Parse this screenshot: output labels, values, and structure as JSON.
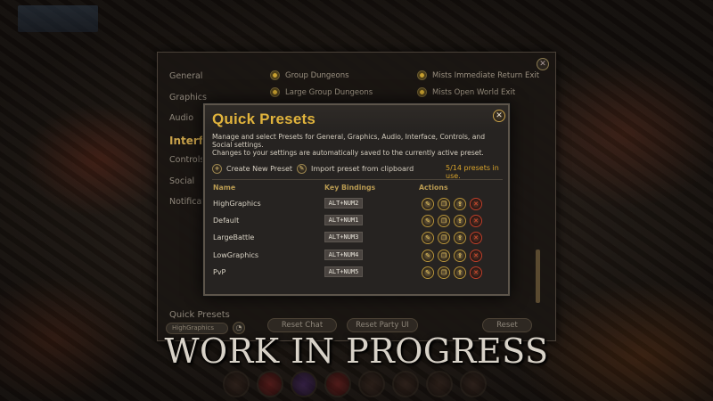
{
  "settings_window": {
    "nav": [
      "General",
      "Graphics",
      "Audio",
      "Interfa",
      "Controls",
      "Social",
      "Notificat"
    ],
    "active_nav": 3,
    "options_left": [
      "Group Dungeons",
      "Large Group Dungeons"
    ],
    "options_right": [
      "Mists Immediate Return Exit",
      "Mists Open World Exit"
    ],
    "quick_presets_label": "Quick Presets",
    "quick_presets_selected": "HighGraphics",
    "reset_chat": "Reset Chat",
    "reset_party_ui": "Reset Party UI",
    "reset": "Reset"
  },
  "dialog": {
    "title": "Quick Presets",
    "description_1": "Manage and select Presets for General, Graphics, Audio, Interface, Controls, and Social settings.",
    "description_2": "Changes to your settings are automatically saved to the currently active preset.",
    "create_label": "Create New Preset",
    "import_label": "Import preset from clipboard",
    "count": "5/14 presets in use.",
    "col_name": "Name",
    "col_keys": "Key Bindings",
    "col_actions": "Actions",
    "presets": [
      {
        "name": "HighGraphics",
        "key": "ALT+NUM2"
      },
      {
        "name": "Default",
        "key": "ALT+NUM1"
      },
      {
        "name": "LargeBattle",
        "key": "ALT+NUM3"
      },
      {
        "name": "LowGraphics",
        "key": "ALT+NUM4"
      },
      {
        "name": "PvP",
        "key": "ALT+NUM5"
      }
    ]
  },
  "watermark": "WORK IN PROGRESS",
  "icons": {
    "close": "close-icon",
    "create": "plus-icon",
    "import": "clipboard-import-icon",
    "row_actions": [
      "edit-icon",
      "copy-icon",
      "export-icon",
      "delete-icon"
    ]
  },
  "colors": {
    "title_gold": "#e0b33c",
    "count_gold": "#d8a42c",
    "delete_red": "#e85030"
  }
}
